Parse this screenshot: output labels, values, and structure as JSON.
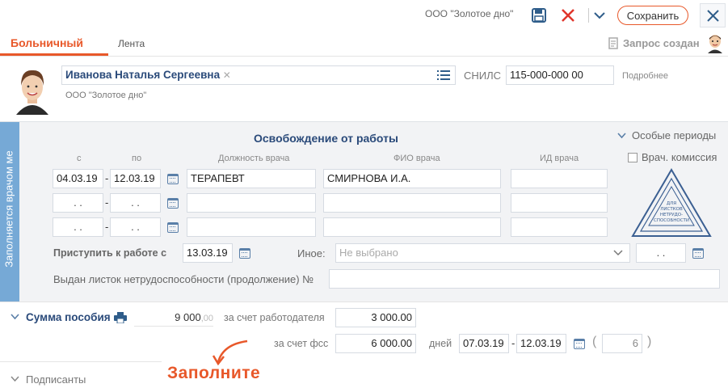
{
  "header": {
    "org": "ООО \"Золотое дно\"",
    "save_label": "Сохранить"
  },
  "tabs": [
    {
      "label": "Больничный"
    },
    {
      "label": "Лента"
    }
  ],
  "request_status": "Запрос создан",
  "patient": {
    "name": "Иванова Наталья Сергеевна",
    "org": "ООО \"Золотое дно\"",
    "snils_label": "СНИЛС",
    "snils": "115-000-000 00",
    "more_label": "Подробнее"
  },
  "side_stripe": "Заполняется врачом ме",
  "release": {
    "title": "Освобождение от работы",
    "special_periods": "Особые периоды",
    "commission": "Врач. комиссия",
    "col_from": "с",
    "col_to": "по",
    "col_position": "Должность врача",
    "col_name": "ФИО врача",
    "col_id": "ИД врача",
    "rows": [
      {
        "from": "04.03.19",
        "to": "12.03.19",
        "position": "ТЕРАПЕВТ",
        "doctor": "СМИРНОВА И.А.",
        "id": ""
      },
      {
        "from": ". .",
        "to": ". .",
        "position": "",
        "doctor": "",
        "id": ""
      },
      {
        "from": ". .",
        "to": ". .",
        "position": "",
        "doctor": "",
        "id": ""
      }
    ],
    "dash": "-",
    "start_label": "Приступить к работе с",
    "start_date": "13.03.19",
    "other_label": "Иное:",
    "other_placeholder": "Не выбрано",
    "other_date": ". .",
    "issued_label": "Выдан листок нетрудоспособности (продолжение) №"
  },
  "stamp": {
    "lines": [
      "ДЛЯ",
      "ЛИСТКОВ",
      "НЕТРУДО-",
      "СПОСОБНОСТИ"
    ]
  },
  "benefit": {
    "title": "Сумма пособия",
    "total": "9 000",
    "total_cents": ",00",
    "employer_label": "за счет работодателя",
    "employer_sum": "3 000.00",
    "fss_label": "за счет фсс",
    "fss_sum": "6 000.00",
    "days_label": "дней",
    "from": "07.03.19",
    "to": "12.03.19",
    "paren_open": "(",
    "days": "6",
    "paren_close": ")"
  },
  "annotation": "Заполните",
  "signers": "Подписанты",
  "colors": {
    "accent": "#e8582a",
    "blue_stripe": "#76a9d6",
    "title_blue": "#2a4a7a"
  }
}
